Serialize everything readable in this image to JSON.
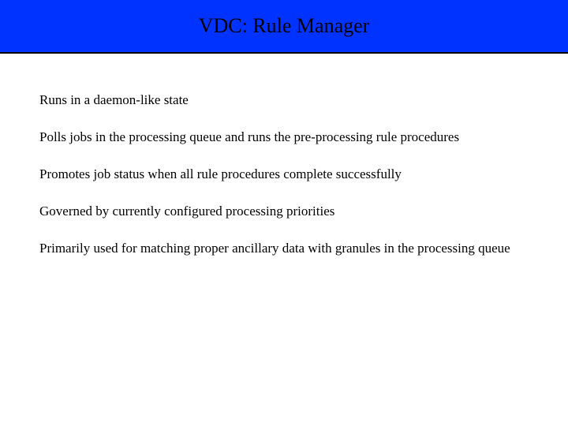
{
  "title": "VDC: Rule Manager",
  "bullets": [
    "Runs in a daemon-like state",
    "Polls jobs in the processing queue and runs the pre-processing rule procedures",
    "Promotes job status when all rule procedures complete successfully",
    "Governed by currently configured processing priorities",
    "Primarily used for matching proper ancillary data with granules in the processing queue"
  ]
}
